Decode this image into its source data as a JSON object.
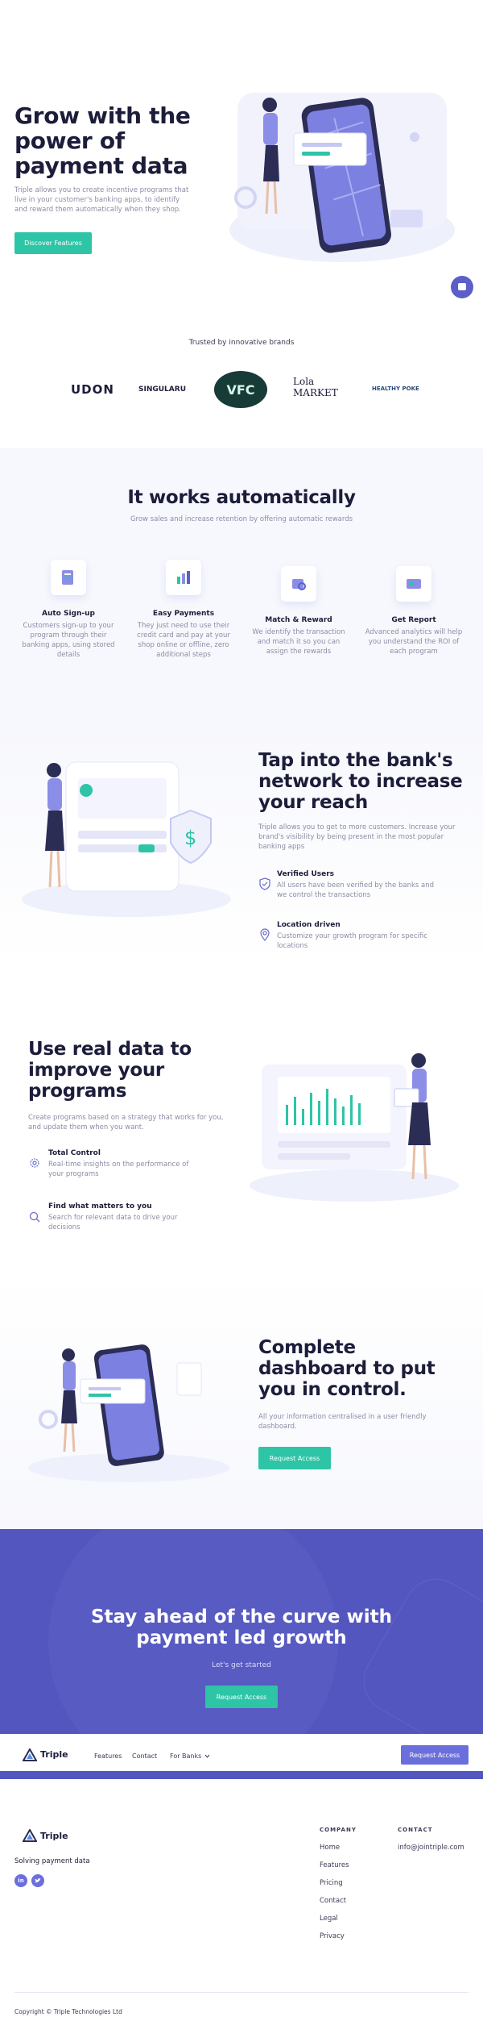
{
  "hero": {
    "title_line1": "Grow with the",
    "title_line2": "power of",
    "title_line3": "payment data",
    "desc_line1": "Triple allows you to create incentive programs that",
    "desc_line2": "live in your customer's banking apps, to identify",
    "desc_line3": "and reward them automatically when they shop.",
    "cta": "Discover Features"
  },
  "brands": {
    "heading": "Trusted by innovative brands",
    "items": [
      "UDON",
      "SINGULARU",
      "VFC",
      "Lola MARKET",
      "HEALTHY POKE"
    ]
  },
  "works": {
    "title": "It works automatically",
    "subtitle": "Grow sales and increase retention by offering automatic rewards",
    "features": [
      {
        "title": "Auto Sign-up",
        "l1": "Customers sign-up to your",
        "l2": "program through their",
        "l3": "banking apps, using stored",
        "l4": "details"
      },
      {
        "title": "Easy Payments",
        "l1": "They just need to use their",
        "l2": "credit card and pay at your",
        "l3": "shop online or offline, zero",
        "l4": "additional steps"
      },
      {
        "title": "Match & Reward",
        "l1": "We identify the transaction",
        "l2": "and match it so you can",
        "l3": "assign the rewards",
        "l4": ""
      },
      {
        "title": "Get Report",
        "l1": "Advanced analytics will help",
        "l2": "you understand the ROI of",
        "l3": "each program",
        "l4": ""
      }
    ]
  },
  "network": {
    "title_line1": "Tap into the bank's",
    "title_line2": "network to increase",
    "title_line3": "your reach",
    "desc_line1": "Triple allows you to get to more customers. Increase your",
    "desc_line2": "brand's visibility by being present in the most popular",
    "desc_line3": "banking apps",
    "items": [
      {
        "title": "Verified Users",
        "l1": "All users have been verified by the banks and",
        "l2": "we control the transactions"
      },
      {
        "title": "Location driven",
        "l1": "Customize your growth program for specific",
        "l2": "locations"
      }
    ]
  },
  "realdata": {
    "title_line1": "Use real data to",
    "title_line2": "improve your",
    "title_line3": "programs",
    "desc_line1": "Create programs based on a strategy that works for you,",
    "desc_line2": "and update them when you want.",
    "items": [
      {
        "title": "Total Control",
        "l1": "Real-time insights on the performance of",
        "l2": "your programs"
      },
      {
        "title": "Find what matters to you",
        "l1": "Search for relevant data to drive your",
        "l2": "decisions"
      }
    ]
  },
  "dashboard": {
    "title_line1": "Complete",
    "title_line2": "dashboard to put",
    "title_line3": "you in control.",
    "desc_line1": "All your information centralised in a user friendly",
    "desc_line2": "dashboard.",
    "cta": "Request Access"
  },
  "cta_band": {
    "title_line1": "Stay ahead of the curve with",
    "title_line2": "payment led growth",
    "subtitle": "Let's get started",
    "cta": "Request Access"
  },
  "navbar": {
    "logo": "Triple",
    "links": [
      "Features",
      "Contact",
      "For Banks"
    ],
    "cta": "Request Access"
  },
  "footer": {
    "logo": "Triple",
    "tagline": "Solving payment data",
    "company_head": "COMPANY",
    "company_links": [
      "Home",
      "Features",
      "Pricing",
      "Contact",
      "Legal",
      "Privacy"
    ],
    "contact_head": "CONTACT",
    "contact_email": "info@jointriple.com",
    "copyright": "Copyright © Triple Technologies Ltd"
  },
  "colors": {
    "accent": "#2ec4a6",
    "brand_purple": "#5b5fc7",
    "dark": "#1c1d3a"
  }
}
